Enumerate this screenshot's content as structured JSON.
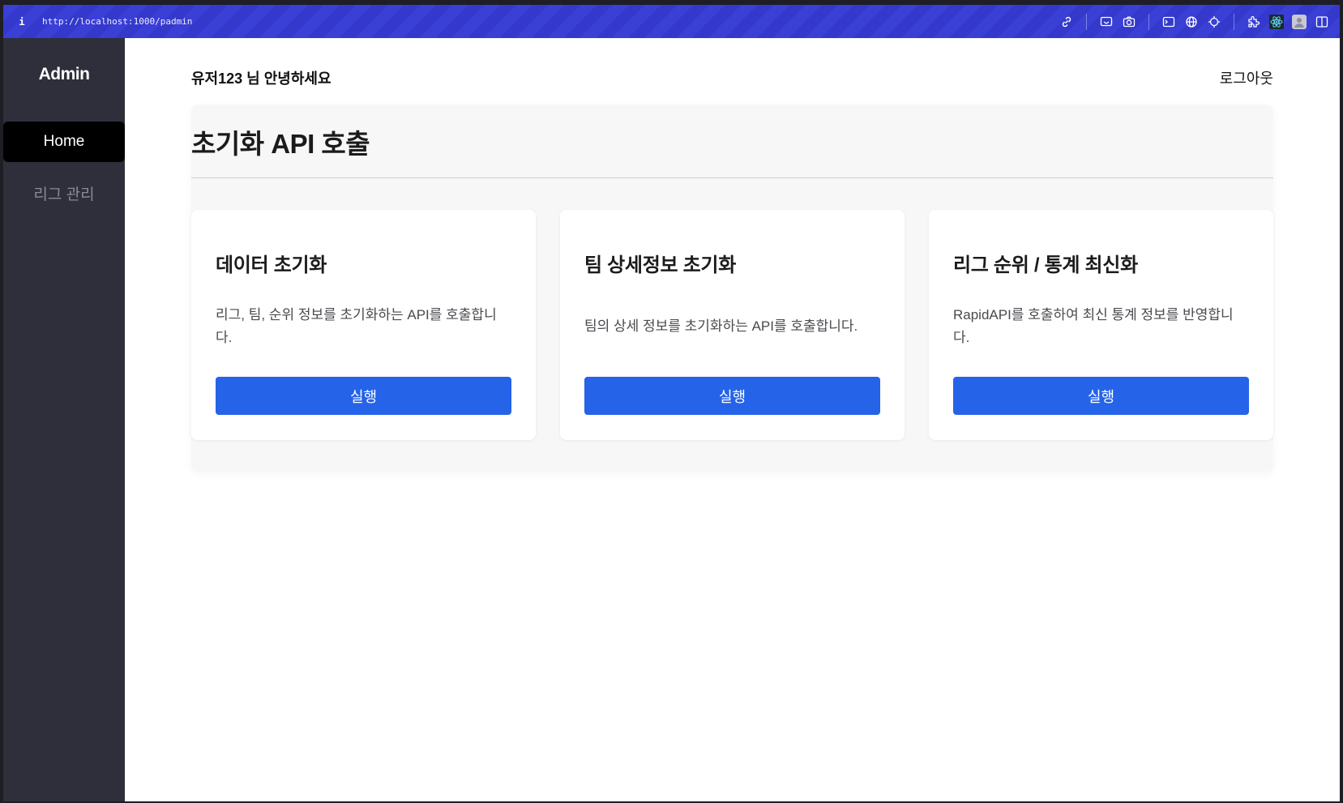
{
  "browser": {
    "info_label": "i",
    "url": "http://localhost:1000/padmin"
  },
  "toolbar_icons": [
    "link-icon",
    "cast-icon",
    "camera-icon",
    "terminal-icon",
    "globe-icon",
    "crosshair-icon",
    "extensions-icon",
    "react-icon",
    "profile-icon",
    "split-view-icon"
  ],
  "sidebar": {
    "brand": "Admin",
    "items": [
      {
        "label": "Home",
        "active": true
      },
      {
        "label": "리그 관리",
        "active": false
      }
    ]
  },
  "header": {
    "greeting": "유저123 님 안녕하세요",
    "logout": "로그아웃"
  },
  "panel": {
    "title": "초기화 API 호출"
  },
  "cards": [
    {
      "title": "데이터 초기화",
      "description": "리그, 팀, 순위 정보를 초기화하는 API를 호출합니다.",
      "button": "실행"
    },
    {
      "title": "팀 상세정보 초기화",
      "description": "팀의 상세 정보를 초기화하는 API를 호출합니다.",
      "button": "실행"
    },
    {
      "title": "리그 순위 / 통계 최신화",
      "description": "RapidAPI를 호출하여 최신 통계 정보를 반영합니다.",
      "button": "실행"
    }
  ],
  "colors": {
    "accent": "#2563e8",
    "sidebar_bg": "#2e2f3a",
    "browser_bar": "#3a3fd6"
  }
}
